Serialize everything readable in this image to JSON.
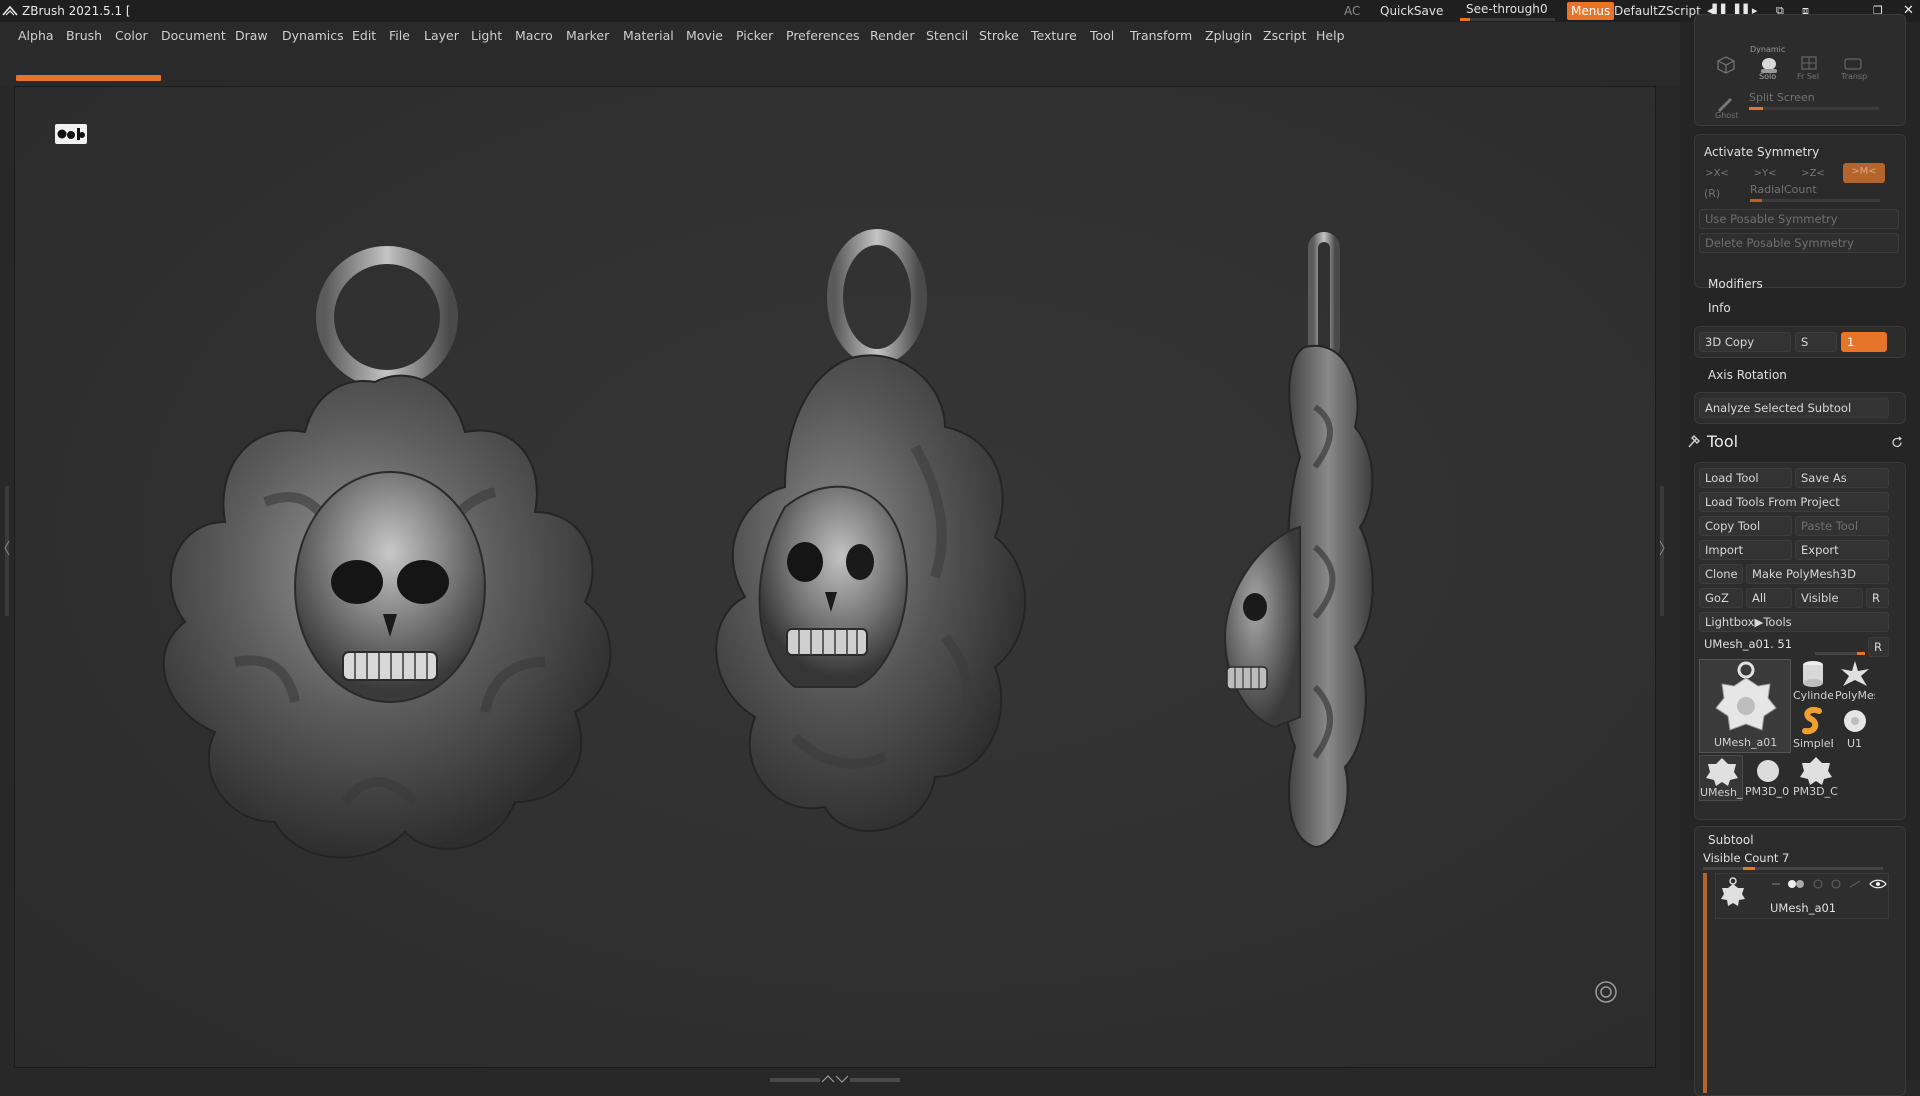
{
  "titlebar": {
    "app_title": "ZBrush 2021.5.1 [",
    "ac": "AC",
    "quicksave": "QuickSave",
    "seethrough_label": "See-through",
    "seethrough_value": "0",
    "seethrough_level": 0.1,
    "menus": "Menus",
    "default_zscript": "DefaultZScript",
    "accent_color": "#e8742a"
  },
  "menu": {
    "items": [
      "Alpha",
      "Brush",
      "Color",
      "Document",
      "Draw",
      "Dynamics",
      "Edit",
      "File",
      "Layer",
      "Light",
      "Macro",
      "Marker",
      "Material",
      "Movie",
      "Picker",
      "Preferences",
      "Render",
      "Stencil",
      "Stroke",
      "Texture",
      "Tool",
      "Transform",
      "Zplugin",
      "Zscript",
      "Help"
    ]
  },
  "panel": {
    "top_box": {
      "dynamic": "Dynamic",
      "solo": "Solo",
      "frsel": "Fr Sel",
      "transp": "Transp",
      "ghost": "Ghost",
      "split_screen": "Split Screen"
    },
    "symmetry": {
      "activate": "Activate Symmetry",
      "x": ">X<",
      "y": ">Y<",
      "z": ">Z<",
      "m": ">M<",
      "r": "(R)",
      "radial_count": "RadialCount",
      "use_posable": "Use Posable Symmetry",
      "delete_posable": "Delete Posable Symmetry"
    },
    "modifiers": "Modifiers",
    "info": "Info",
    "copy3d": "3D Copy",
    "copy3d_s": "S",
    "copy3d_value": "1",
    "axis_rotation": "Axis Rotation",
    "analyze": "Analyze Selected Subtool"
  },
  "tool": {
    "title": "Tool",
    "load_tool": "Load Tool",
    "save_as": "Save As",
    "load_from_project": "Load Tools From Project",
    "copy_tool": "Copy Tool",
    "paste_tool": "Paste Tool",
    "import": "Import",
    "export": "Export",
    "clone": "Clone",
    "make_polymesh": "Make PolyMesh3D",
    "goz": "GoZ",
    "all": "All",
    "visible": "Visible",
    "r": "R",
    "lightbox": "Lightbox▶Tools",
    "current_tool": "UMesh_a01. 51",
    "current_r": "R",
    "thumbs": {
      "main": "UMesh_a01",
      "cylinder": "Cylinder",
      "polymesh": "PolyMes",
      "simpleb": "SimpleB",
      "u1": "U1",
      "umesh_small": "UMesh_",
      "pm3d_1": "PM3D_0",
      "pm3d_2": "PM3D_C"
    }
  },
  "subtool": {
    "title": "Subtool",
    "visible_count": "Visible Count 7",
    "item_name": "UMesh_a01"
  }
}
